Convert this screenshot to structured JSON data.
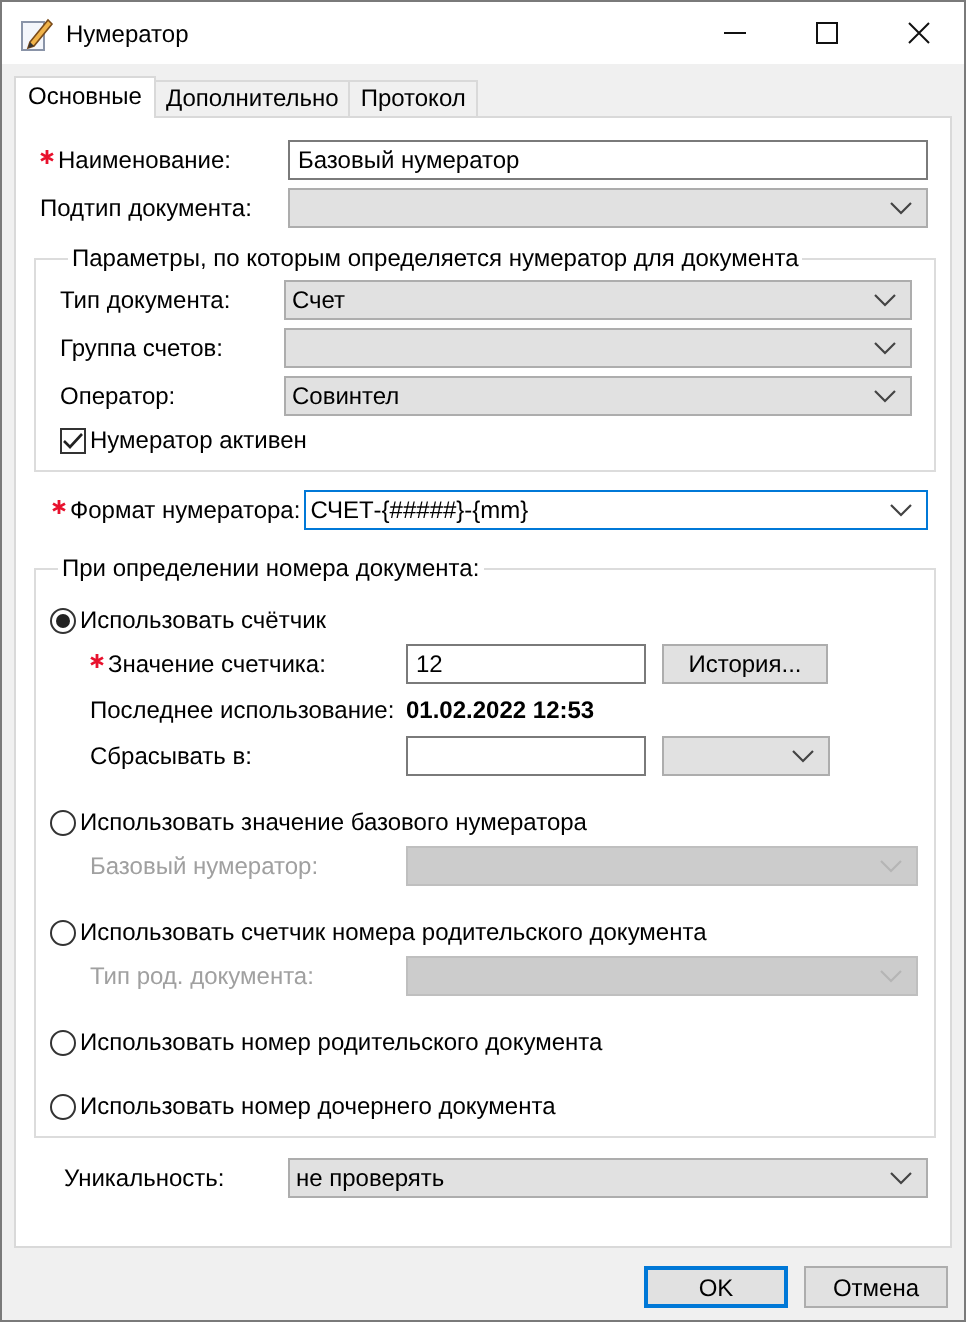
{
  "window": {
    "title": "Нумератор"
  },
  "tabs": [
    {
      "label": "Основные",
      "selected": true
    },
    {
      "label": "Дополнительно",
      "selected": false
    },
    {
      "label": "Протокол",
      "selected": false
    }
  ],
  "name_field": {
    "label": "Наименование:",
    "required": true,
    "controls": [
      {
        "kind": "text",
        "value": "Базовый нумератор"
      }
    ]
  },
  "subtype_field": {
    "label": "Подтип документа:",
    "required": false,
    "controls": [
      {
        "kind": "combo"
      }
    ]
  },
  "parameters_group": {
    "legend": "Параметры, по которым определяется нумератор для документа",
    "rows": [
      {
        "label": "Тип документа:",
        "required": false,
        "controls": [
          {
            "kind": "combo",
            "value": "Счет"
          }
        ]
      },
      {
        "label": "Группа счетов:",
        "required": false,
        "controls": [
          {
            "kind": "combo"
          }
        ]
      },
      {
        "label": "Оператор:",
        "required": false,
        "controls": [
          {
            "kind": "combo",
            "value": "Совинтел"
          }
        ]
      }
    ],
    "checkbox": {
      "label": "Нумератор активен",
      "checked": true
    }
  },
  "format_field": {
    "label": "Формат нумератора:",
    "required": true,
    "controls": [
      {
        "kind": "combo",
        "value": "СЧЕТ-{#####}-{mm}",
        "focused": true
      }
    ]
  },
  "numbering_group": {
    "legend": "При определении номера документа:",
    "options": [
      {
        "label": "Использовать счётчик",
        "selected": true,
        "rows": [
          {
            "label": "Значение счетчика:",
            "required": true,
            "controls": [
              {
                "kind": "text",
                "value": "12"
              },
              {
                "kind": "button",
                "label": "История..."
              }
            ]
          },
          {
            "label": "Последнее использование:",
            "required": false,
            "controls": [
              {
                "kind": "info",
                "value": "01.02.2022 12:53"
              }
            ]
          },
          {
            "label": "Сбрасывать в:",
            "required": false,
            "controls": [
              {
                "kind": "text"
              },
              {
                "kind": "combo"
              }
            ]
          }
        ]
      },
      {
        "label": "Использовать значение базового нумератора",
        "selected": false,
        "rows": [
          {
            "label": "Базовый нумератор:",
            "required": false,
            "disabled": true,
            "controls": [
              {
                "kind": "combo"
              }
            ]
          }
        ]
      },
      {
        "label": "Использовать счетчик номера родительского документа",
        "selected": false,
        "rows": [
          {
            "label": "Тип род. документа:",
            "required": false,
            "disabled": true,
            "controls": [
              {
                "kind": "combo"
              }
            ]
          }
        ]
      },
      {
        "label": "Использовать номер родительского документа",
        "selected": false
      },
      {
        "label": "Использовать номер дочернего документа",
        "selected": false
      }
    ]
  },
  "uniqueness_field": {
    "label": "Уникальность:",
    "required": false,
    "controls": [
      {
        "kind": "combo",
        "value": "не проверять"
      }
    ]
  },
  "buttons": [
    {
      "label": "OK",
      "default": true
    },
    {
      "label": "Отмена",
      "default": false
    }
  ]
}
